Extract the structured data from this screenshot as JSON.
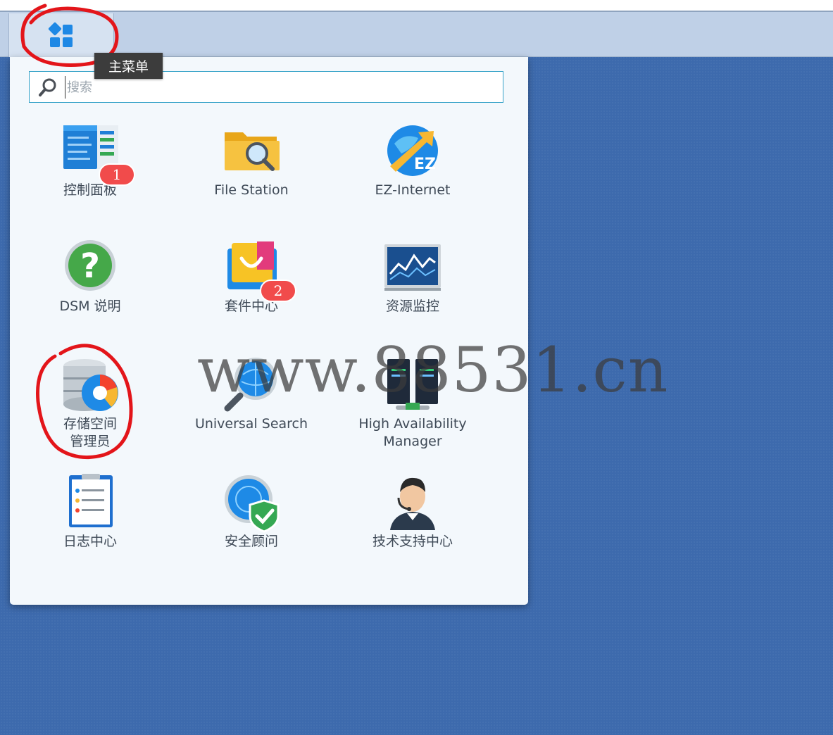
{
  "taskbar": {
    "main_menu_tooltip": "主菜单"
  },
  "search": {
    "placeholder": "搜索"
  },
  "apps": [
    {
      "label": "控制面板",
      "icon": "control-panel-icon",
      "badge": "1"
    },
    {
      "label": "File Station",
      "icon": "file-station-icon"
    },
    {
      "label": "EZ-Internet",
      "icon": "ez-internet-icon",
      "icon_text": "EZ"
    },
    {
      "label": "DSM 说明",
      "icon": "dsm-help-icon",
      "icon_text": "?"
    },
    {
      "label": "套件中心",
      "icon": "package-center-icon",
      "badge": "2"
    },
    {
      "label": "资源监控",
      "icon": "resource-monitor-icon"
    },
    {
      "label": "存储空间\n管理员",
      "icon": "storage-manager-icon"
    },
    {
      "label": "Universal Search",
      "icon": "universal-search-icon"
    },
    {
      "label": "High Availability\nManager",
      "icon": "high-availability-icon"
    },
    {
      "label": "日志中心",
      "icon": "log-center-icon"
    },
    {
      "label": "安全顾问",
      "icon": "security-advisor-icon"
    },
    {
      "label": "技术支持中心",
      "icon": "support-center-icon"
    }
  ],
  "watermark": "www.88531.cn",
  "colors": {
    "desktop": "#3d6aad",
    "taskbar": "#bfd0e7",
    "panel": "#f3f8fc",
    "badge": "#f14b4b",
    "annotation": "#e3151a"
  }
}
